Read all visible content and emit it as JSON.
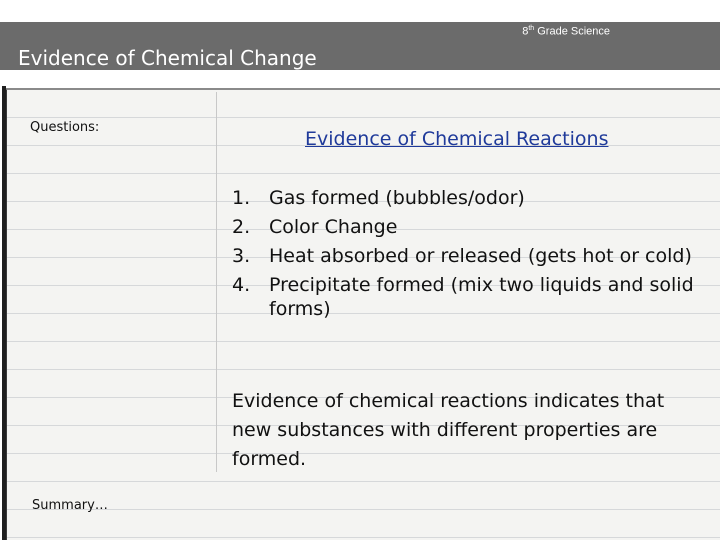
{
  "header": {
    "grade_label": "8",
    "grade_sup": "th",
    "grade_subject": "Grade Science",
    "slide_title": "Evidence of Chemical Change"
  },
  "sidebar": {
    "questions_label": "Questions:",
    "summary_label": "Summary…"
  },
  "main": {
    "heading": "Evidence of Chemical Reactions",
    "list": [
      {
        "num": "1.",
        "text": "Gas formed (bubbles/odor)"
      },
      {
        "num": "2.",
        "text": "Color Change"
      },
      {
        "num": "3.",
        "text": "Heat absorbed or released (gets hot or cold)"
      },
      {
        "num": "4.",
        "text": "Precipitate formed (mix two liquids and solid forms)"
      }
    ],
    "conclusion": "Evidence of chemical reactions indicates that new substances with different properties are formed."
  },
  "colors": {
    "header_bar": "#6b6b6b",
    "heading_link": "#1f3a9a",
    "paper": "#f4f4f2"
  }
}
